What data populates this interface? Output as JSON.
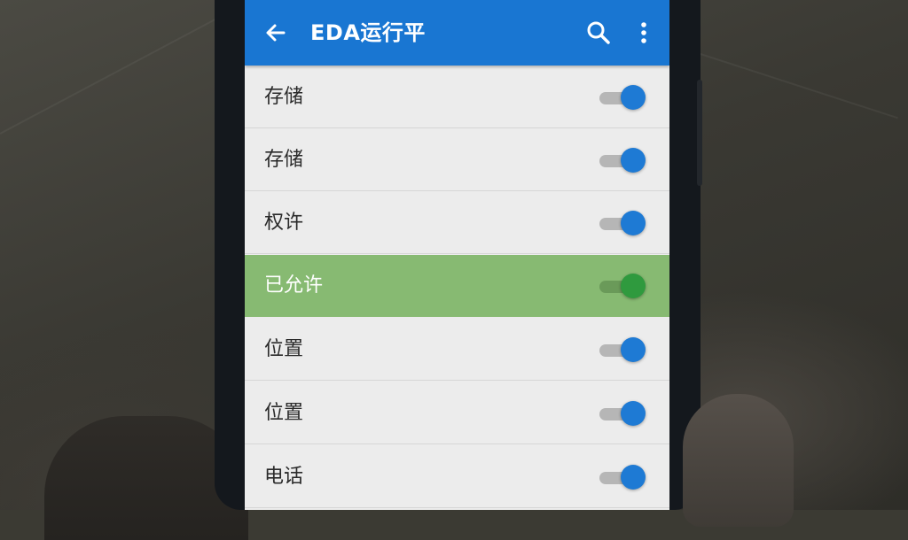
{
  "appbar": {
    "title": "EDA运行平",
    "back_icon": "arrow-back-icon",
    "search_icon": "search-icon",
    "more_icon": "more-vert-icon",
    "color": "#1976d2"
  },
  "permissions": {
    "items": [
      {
        "label": "存储",
        "enabled": true,
        "selected": false
      },
      {
        "label": "存储",
        "enabled": true,
        "selected": false
      },
      {
        "label": "权许",
        "enabled": true,
        "selected": false
      },
      {
        "label": "已允许",
        "enabled": true,
        "selected": true
      },
      {
        "label": "位置",
        "enabled": true,
        "selected": false
      },
      {
        "label": "位置",
        "enabled": true,
        "selected": false
      },
      {
        "label": "电话",
        "enabled": true,
        "selected": false
      }
    ]
  },
  "colors": {
    "switch_on": "#1e7ad4",
    "selected_row": "#87ba72",
    "selected_switch": "#2f9a3e"
  }
}
